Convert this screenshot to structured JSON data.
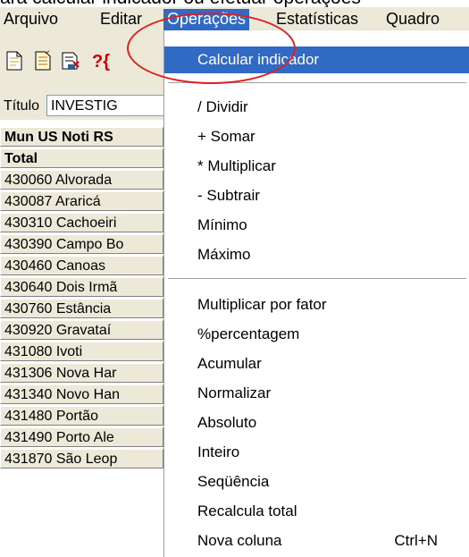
{
  "caption": "ara calcular indicador ou efetuar operações",
  "menubar": {
    "items": [
      "Arquivo",
      "Editar",
      "Operações",
      "Estatísticas",
      "Quadro"
    ]
  },
  "toolbar": {
    "icons": [
      "new-document-icon",
      "open-document-icon",
      "save-document-icon",
      "calculate-icon"
    ],
    "calc_glyph": "?{"
  },
  "title_row": {
    "label": "Título",
    "value": "INVESTIG"
  },
  "table": {
    "header": "Mun US Noti RS",
    "total": "Total",
    "rows": [
      "430060 Alvorada",
      "430087 Araricá",
      "430310 Cachoeiri",
      "430390 Campo Bo",
      "430460 Canoas",
      "430640 Dois Irmã",
      "430760 Estância",
      "430920 Gravataí",
      "431080 Ivoti",
      "431306 Nova Har",
      "431340 Novo Han",
      "431480 Portão",
      "431490 Porto Ale",
      "431870 São Leop"
    ]
  },
  "menu": {
    "items": [
      "Calcular indicador",
      "/ Dividir",
      "+ Somar",
      "* Multiplicar",
      "- Subtrair",
      "Mínimo",
      "Máximo",
      "Multiplicar por fator",
      "%percentagem",
      "Acumular",
      "Normalizar",
      "Absoluto",
      "Inteiro",
      "Seqüência",
      "Recalcula total",
      "Nova coluna"
    ],
    "shortcut_nova_coluna": "Ctrl+N"
  },
  "colors": {
    "highlight": "#316ac5",
    "annotation_circle": "#e02020",
    "menubar_bg": "#ece9d8"
  }
}
